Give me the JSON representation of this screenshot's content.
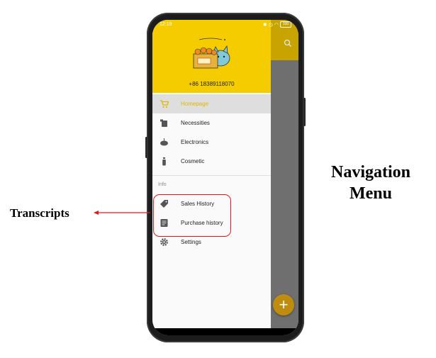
{
  "status_bar": {
    "time": "12:19",
    "battery": "100"
  },
  "drawer": {
    "phone_number": "+86 18389118070",
    "active_color": "#e0b800",
    "header_color": "#f5cc00",
    "items": [
      {
        "label": "Homepage",
        "icon": "cart-icon",
        "active": true
      },
      {
        "label": "Necessities",
        "icon": "cup-icon",
        "active": false
      },
      {
        "label": "Electronics",
        "icon": "gamepad-icon",
        "active": false
      },
      {
        "label": "Cosmetic",
        "icon": "bottle-icon",
        "active": false
      }
    ],
    "info_section": {
      "title": "Info",
      "items": [
        {
          "label": "Sales History",
          "icon": "tag-icon"
        },
        {
          "label": "Purchase history",
          "icon": "document-icon"
        },
        {
          "label": "Settings",
          "icon": "gear-icon"
        }
      ]
    }
  },
  "fab": {
    "label": "+"
  },
  "annotations": {
    "left_label": "Transcripts",
    "title_line1": "Navigation",
    "title_line2": "Menu",
    "highlight_color": "#e01a1a"
  }
}
